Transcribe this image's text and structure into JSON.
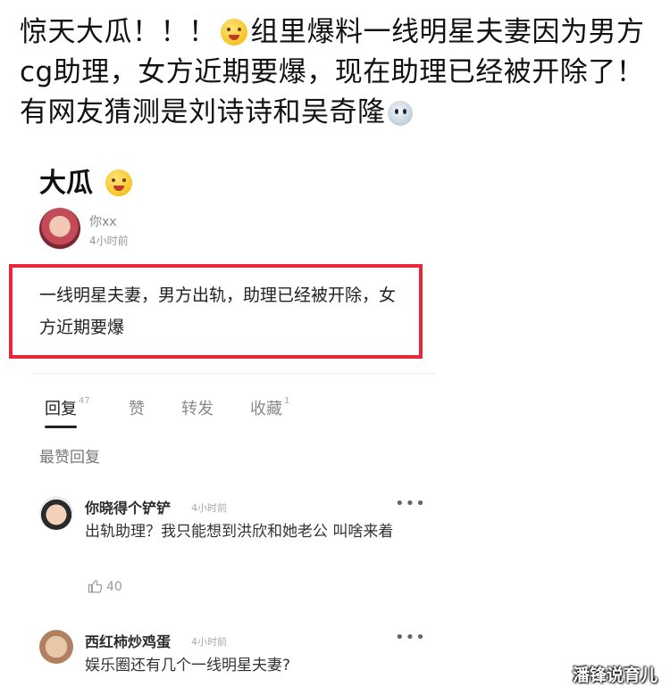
{
  "headline": {
    "part1": "惊天大瓜！！！",
    "part2": "组里爆料一线明星夫妻因为男方cg助理，女方近期要爆，现在助理已经被开除了！有网友猜测是刘诗诗和吴奇隆"
  },
  "post": {
    "title": "大瓜",
    "author": "你xx",
    "time": "4小时前",
    "body": "一线明星夫妻，男方出轨，助理已经被开除，女方近期要爆"
  },
  "tabs": [
    {
      "label": "回复",
      "count": "47"
    },
    {
      "label": "赞",
      "count": ""
    },
    {
      "label": "转发",
      "count": ""
    },
    {
      "label": "收藏",
      "count": "1"
    }
  ],
  "section_label": "最赞回复",
  "comments": [
    {
      "name": "你晓得个铲铲",
      "time": "4小时前",
      "body": "出轨助理？我只能想到洪欣和她老公 叫啥来着",
      "likes": "40"
    },
    {
      "name": "西红柿炒鸡蛋",
      "time": "4小时前",
      "body": "娱乐圈还有几个一线明星夫妻?"
    }
  ],
  "more_glyph": "•••",
  "watermark": "潘锋说育儿",
  "colors": {
    "highlight_border": "#e8273a"
  }
}
